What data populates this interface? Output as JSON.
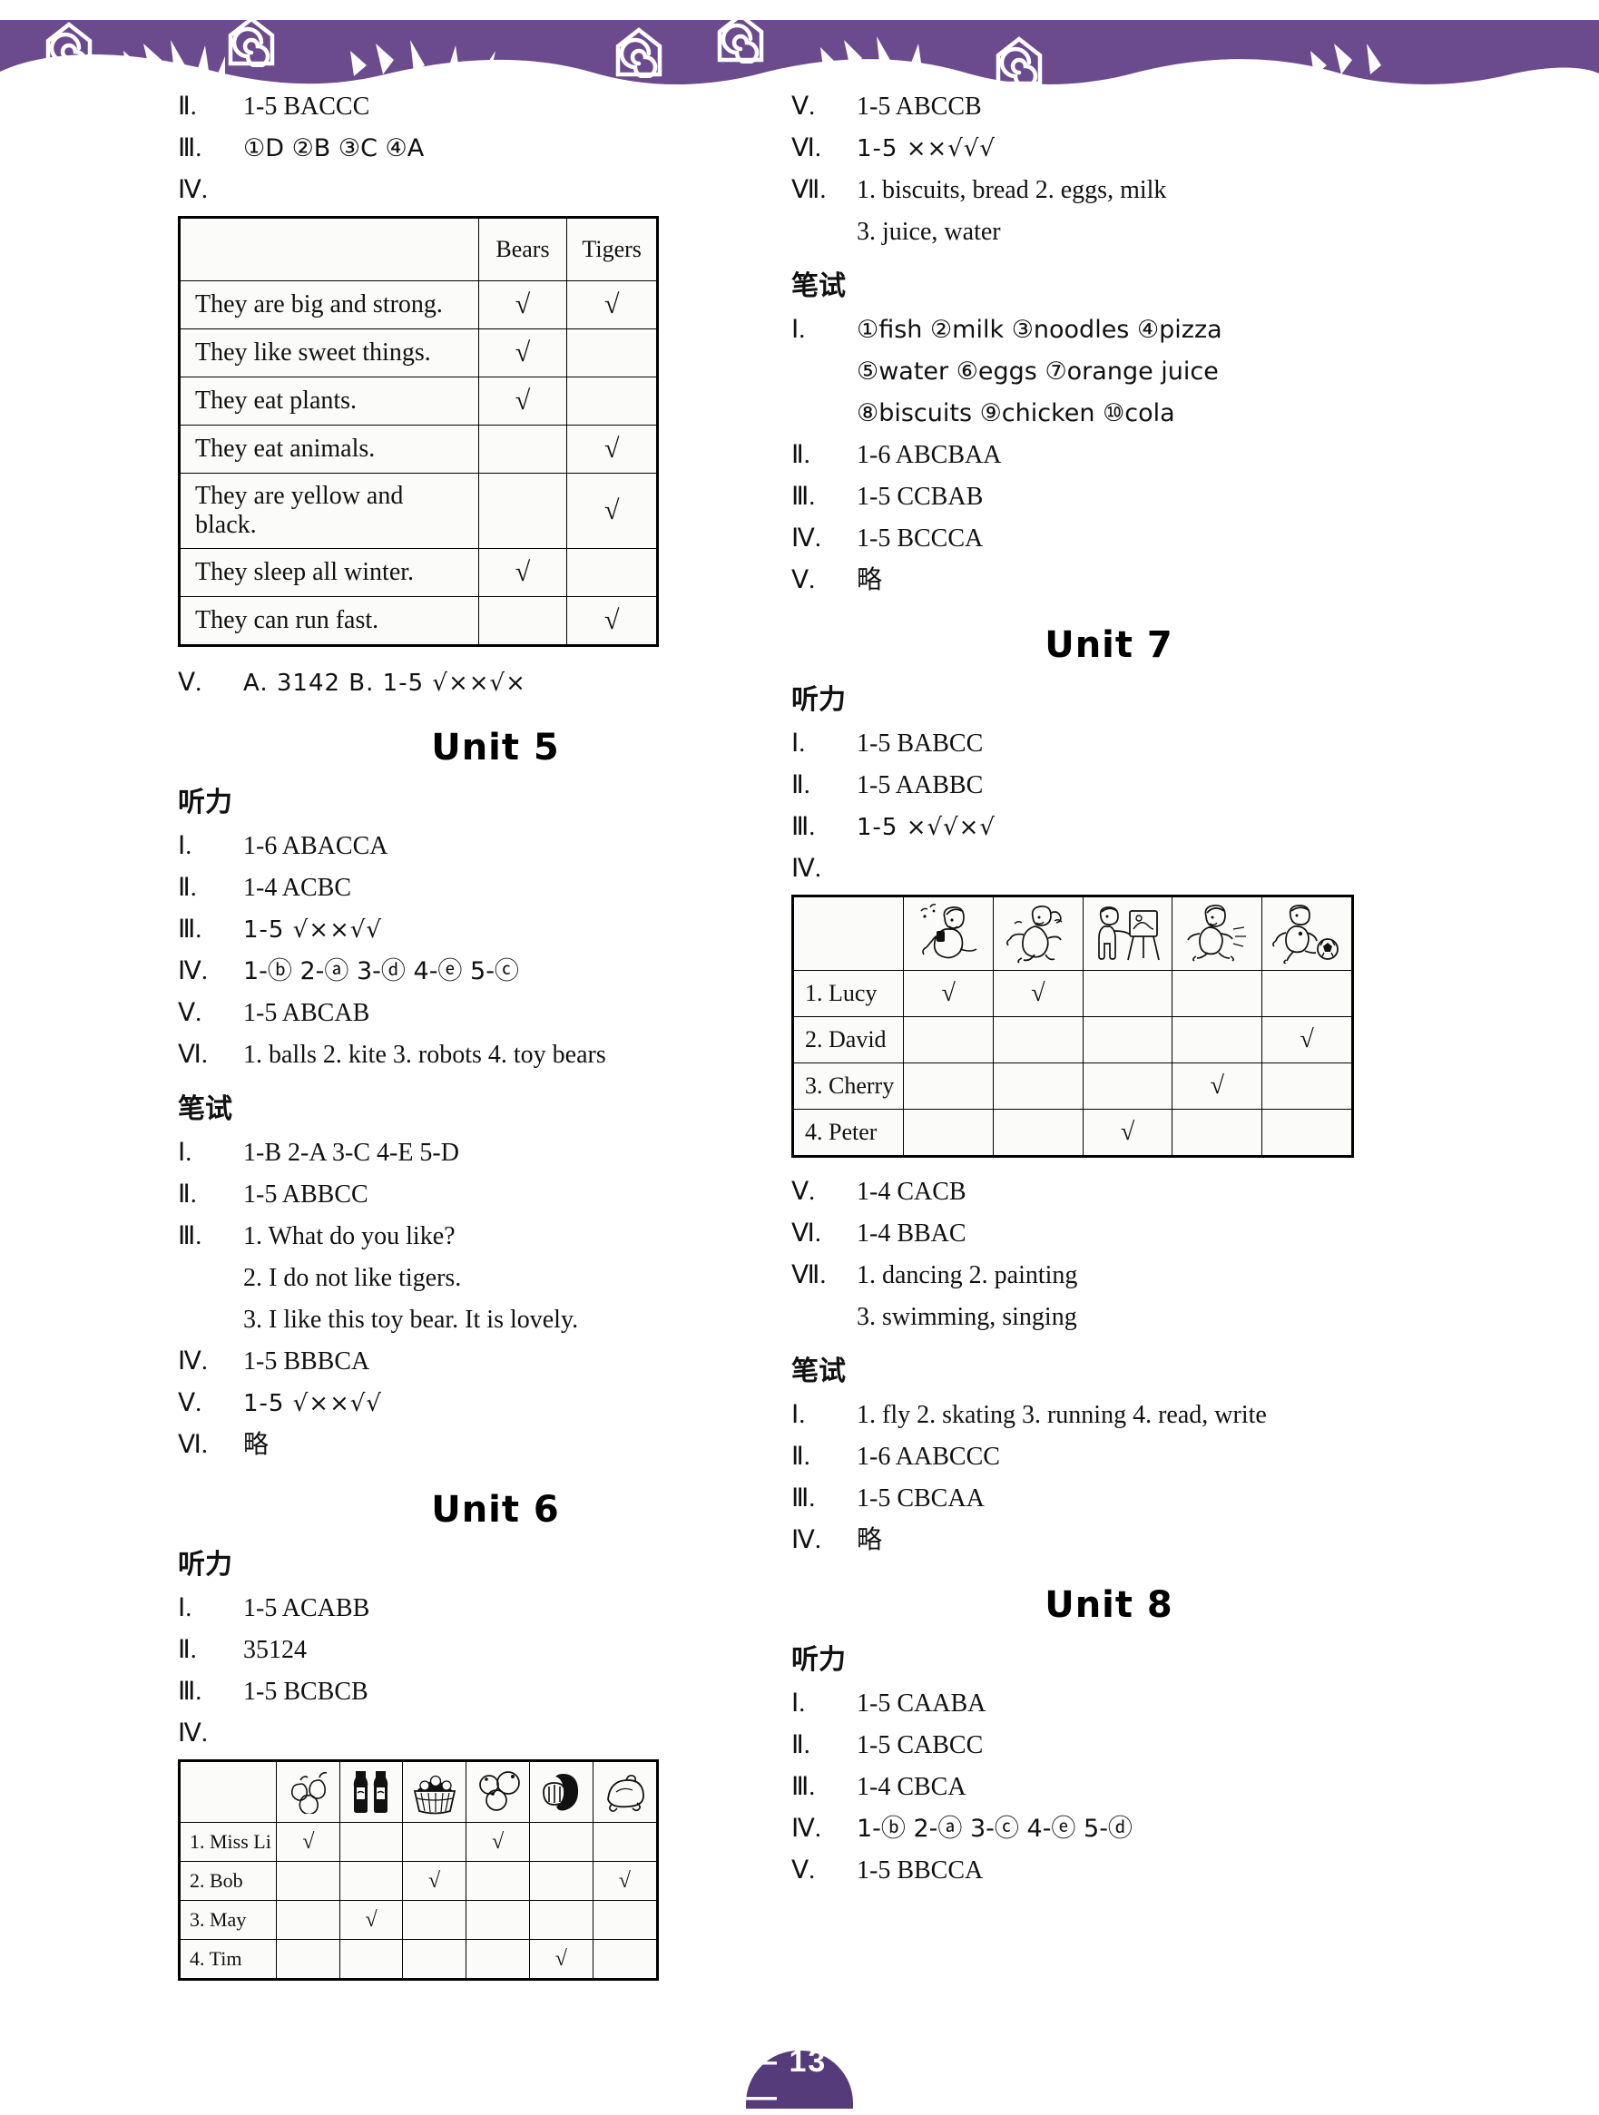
{
  "page": {
    "number": "— 13 —",
    "accent_color": "#6b4a8e",
    "footer_color": "#553b79"
  },
  "left_column": {
    "unit4_tail": {
      "items": [
        {
          "num": "Ⅱ.",
          "text": "1-5   BACCC"
        },
        {
          "num": "Ⅲ.",
          "text": "①D   ②B   ③C   ④A"
        },
        {
          "num": "Ⅳ.",
          "text": ""
        }
      ],
      "table": {
        "headers": [
          "",
          "Bears",
          "Tigers"
        ],
        "rows": [
          {
            "label": "They are big and strong.",
            "bears": "√",
            "tigers": "√"
          },
          {
            "label": "They like sweet things.",
            "bears": "√",
            "tigers": ""
          },
          {
            "label": "They eat plants.",
            "bears": "√",
            "tigers": ""
          },
          {
            "label": "They eat animals.",
            "bears": "",
            "tigers": "√"
          },
          {
            "label": "They are yellow and black.",
            "bears": "",
            "tigers": "√"
          },
          {
            "label": "They sleep all winter.",
            "bears": "√",
            "tigers": ""
          },
          {
            "label": "They can run fast.",
            "bears": "",
            "tigers": "√"
          }
        ]
      },
      "after_table": {
        "num": "Ⅴ.",
        "text": "A. 3142     B. 1-5    √××√×"
      }
    },
    "unit5": {
      "title": "Unit 5",
      "listening_label": "听力",
      "listening": [
        {
          "num": "Ⅰ.",
          "text": "1-6   ABACCA"
        },
        {
          "num": "Ⅱ.",
          "text": "1-4   ACBC"
        },
        {
          "num": "Ⅲ.",
          "text": "1-5   √××√√"
        },
        {
          "num": "Ⅳ.",
          "text": "1-ⓑ  2-ⓐ  3-ⓓ  4-ⓔ  5-ⓒ"
        },
        {
          "num": "Ⅴ.",
          "text": "1-5   ABCAB"
        },
        {
          "num": "Ⅵ.",
          "text": "1. balls   2. kite   3. robots   4. toy bears"
        }
      ],
      "written_label": "笔试",
      "written": [
        {
          "num": "Ⅰ.",
          "text": "1-B   2-A   3-C   4-E   5-D"
        },
        {
          "num": "Ⅱ.",
          "text": "1-5   ABBCC"
        },
        {
          "num": "Ⅲ.",
          "text": "1. What do you like?"
        },
        {
          "num": "",
          "text": "2. I do not like tigers."
        },
        {
          "num": "",
          "text": "3. I like this toy bear. It is lovely."
        },
        {
          "num": "Ⅳ.",
          "text": "1-5   BBBCA"
        },
        {
          "num": "Ⅴ.",
          "text": "1-5   √××√√"
        },
        {
          "num": "Ⅵ.",
          "text": "略"
        }
      ]
    },
    "unit6": {
      "title": "Unit 6",
      "listening_label": "听力",
      "listening": [
        {
          "num": "Ⅰ.",
          "text": "1-5   ACABB"
        },
        {
          "num": "Ⅱ.",
          "text": "35124"
        },
        {
          "num": "Ⅲ.",
          "text": "1-5   BCBCB"
        },
        {
          "num": "Ⅳ.",
          "text": ""
        }
      ],
      "table": {
        "icon_headers": [
          "pears-icon",
          "cola-bottles-icon",
          "fruit-basket-icon",
          "oranges-icon",
          "bread-icon",
          "roast-chicken-icon"
        ],
        "rows": [
          {
            "label": "1. Miss Li",
            "marks": [
              "√",
              "",
              "",
              "√",
              "",
              ""
            ]
          },
          {
            "label": "2. Bob",
            "marks": [
              "",
              "",
              "√",
              "",
              "",
              "√"
            ]
          },
          {
            "label": "3. May",
            "marks": [
              "",
              "√",
              "",
              "",
              "",
              ""
            ]
          },
          {
            "label": "4. Tim",
            "marks": [
              "",
              "",
              "",
              "",
              "√",
              ""
            ]
          }
        ]
      }
    }
  },
  "right_column": {
    "unit6_tail": {
      "listening": [
        {
          "num": "Ⅴ.",
          "text": "1-5   ABCCB"
        },
        {
          "num": "Ⅵ.",
          "text": "1-5   ××√√√"
        },
        {
          "num": "Ⅶ.",
          "text": "1. biscuits, bread    2. eggs, milk"
        },
        {
          "num": "",
          "text": "3. juice, water"
        }
      ],
      "written_label": "笔试",
      "written": [
        {
          "num": "Ⅰ.",
          "text": "①fish   ②milk   ③noodles   ④pizza"
        },
        {
          "num": "",
          "text": "⑤water   ⑥eggs   ⑦orange juice"
        },
        {
          "num": "",
          "text": "⑧biscuits   ⑨chicken   ⑩cola"
        },
        {
          "num": "Ⅱ.",
          "text": "1-6   ABCBAA"
        },
        {
          "num": "Ⅲ.",
          "text": "1-5   CCBAB"
        },
        {
          "num": "Ⅳ.",
          "text": "1-5   BCCCA"
        },
        {
          "num": "Ⅴ.",
          "text": "略"
        }
      ]
    },
    "unit7": {
      "title": "Unit 7",
      "listening_label": "听力",
      "listening": [
        {
          "num": "Ⅰ.",
          "text": "1-5   BABCC"
        },
        {
          "num": "Ⅱ.",
          "text": "1-5   AABBC"
        },
        {
          "num": "Ⅲ.",
          "text": "1-5   ×√√×√"
        },
        {
          "num": "Ⅳ.",
          "text": ""
        }
      ],
      "table": {
        "icon_headers": [
          "singing-girl-icon",
          "dancing-girl-icon",
          "painting-boy-icon",
          "running-girl-icon",
          "football-boy-icon"
        ],
        "rows": [
          {
            "label": "1. Lucy",
            "marks": [
              "√",
              "√",
              "",
              "",
              ""
            ]
          },
          {
            "label": "2. David",
            "marks": [
              "",
              "",
              "",
              "",
              "√"
            ]
          },
          {
            "label": "3. Cherry",
            "marks": [
              "",
              "",
              "",
              "√",
              ""
            ]
          },
          {
            "label": "4. Peter",
            "marks": [
              "",
              "",
              "√",
              "",
              ""
            ]
          }
        ]
      },
      "listening_after": [
        {
          "num": "Ⅴ.",
          "text": "1-4   CACB"
        },
        {
          "num": "Ⅵ.",
          "text": "1-4   BBAC"
        },
        {
          "num": "Ⅶ.",
          "text": "1. dancing   2. painting"
        },
        {
          "num": "",
          "text": "3. swimming, singing"
        }
      ],
      "written_label": "笔试",
      "written": [
        {
          "num": "Ⅰ.",
          "text": "1. fly   2. skating   3. running   4. read, write"
        },
        {
          "num": "Ⅱ.",
          "text": "1-6   AABCCC"
        },
        {
          "num": "Ⅲ.",
          "text": "1-5   CBCAA"
        },
        {
          "num": "Ⅳ.",
          "text": "略"
        }
      ]
    },
    "unit8": {
      "title": "Unit 8",
      "listening_label": "听力",
      "listening": [
        {
          "num": "Ⅰ.",
          "text": "1-5   CAABA"
        },
        {
          "num": "Ⅱ.",
          "text": "1-5   CABCC"
        },
        {
          "num": "Ⅲ.",
          "text": "1-4   CBCA"
        },
        {
          "num": "Ⅳ.",
          "text": "1-ⓑ  2-ⓐ  3-ⓒ  4-ⓔ  5-ⓓ"
        },
        {
          "num": "Ⅴ.",
          "text": "1-5   BBCCA"
        }
      ]
    }
  }
}
